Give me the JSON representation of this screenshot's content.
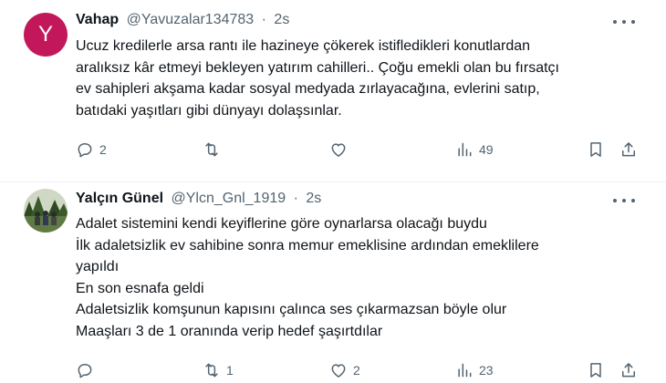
{
  "tweets": [
    {
      "avatar_letter": "Y",
      "name": "Vahap",
      "handle": "@Yavuzalar134783",
      "separator": "·",
      "time": "2s",
      "lines": [
        "Ucuz kredilerle arsa rantı ile hazineye çökerek istifledikleri konutlardan",
        "aralıksız kâr etmeyi bekleyen yatırım cahilleri.. Çoğu emekli olan bu fırsatçı",
        "ev sahipleri akşama kadar sosyal medyada zırlayacağına, evlerini satıp,",
        "batıdaki yaşıtları gibi dünyayı dolaşsınlar."
      ],
      "replies": "2",
      "retweets": "",
      "likes": "",
      "views": "49"
    },
    {
      "name": "Yalçın Günel",
      "handle": "@Ylcn_Gnl_1919",
      "separator": "·",
      "time": "2s",
      "lines": [
        "Adalet sistemini kendi keyiflerine  göre oynarlarsa olacağı buydu",
        "İlk adaletsizlik ev sahibine sonra memur emeklisine ardından emeklilere",
        "yapıldı",
        "En son esnafa geldi",
        "Adaletsizlik komşunun kapısını çalınca ses çıkarmazsan böyle olur",
        "Maaşları 3 de 1 oranında verip hedef şaşırtdılar"
      ],
      "replies": "",
      "retweets": "1",
      "likes": "2",
      "views": "23"
    }
  ]
}
